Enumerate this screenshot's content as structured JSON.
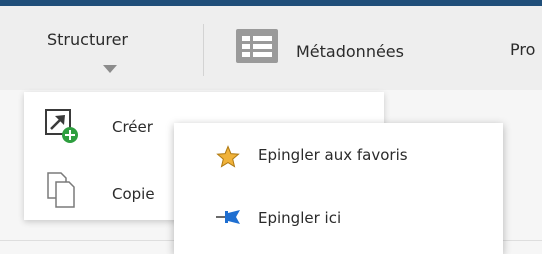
{
  "ribbon": {
    "structurer_label": "Structurer",
    "metadonnees_label": "Métadonnées",
    "cut_label": "Pro"
  },
  "dropdown": {
    "items": [
      {
        "label": "Créer",
        "icon": "create-shortcut-icon"
      },
      {
        "label": "Copie",
        "icon": "copy-icon"
      }
    ]
  },
  "context_menu": {
    "items": [
      {
        "label": "Epingler aux favoris",
        "icon": "star-icon"
      },
      {
        "label": "Epingler ici",
        "icon": "pin-icon"
      }
    ]
  },
  "colors": {
    "topbar": "#1f4e79",
    "ribbon_bg": "#eeeeee",
    "star": "#f0b23a",
    "pin": "#1f6fd1",
    "plus_badge": "#2e9e3f"
  }
}
